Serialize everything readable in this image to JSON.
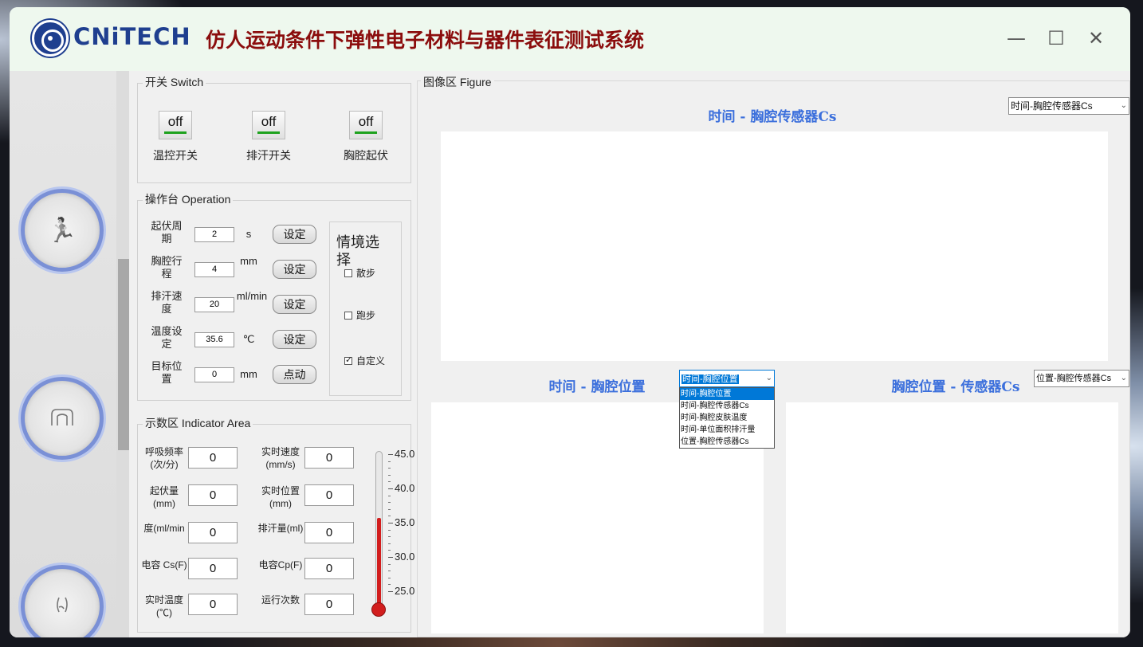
{
  "titlebar": {
    "logo_text": "CNiTECH",
    "app_title": "仿人运动条件下弹性电子材料与器件表征测试系统",
    "minimize_glyph": "—",
    "maximize_glyph": "☐",
    "close_glyph": "✕"
  },
  "nav": {
    "items": [
      {
        "icon": "running-person-icon",
        "glyph": "🏃"
      },
      {
        "icon": "chest-icon",
        "glyph": "⌒"
      },
      {
        "icon": "body-torso-icon",
        "glyph": "ʖ"
      }
    ]
  },
  "switch_panel": {
    "title": "开关 Switch",
    "switches": [
      {
        "state": "off",
        "label": "温控开关"
      },
      {
        "state": "off",
        "label": "排汗开关"
      },
      {
        "state": "off",
        "label": "胸腔起伏"
      }
    ]
  },
  "operation_panel": {
    "title": "操作台 Operation",
    "rows": [
      {
        "label": "起伏周期",
        "value": "2",
        "unit": "s",
        "button": "设定"
      },
      {
        "label": "胸腔行程",
        "value": "4",
        "unit": "mm",
        "button": "设定"
      },
      {
        "label": "排汗速度",
        "value": "20",
        "unit": "ml/min",
        "button": "设定"
      },
      {
        "label": "温度设定",
        "value": "35.6",
        "unit": "℃",
        "button": "设定"
      },
      {
        "label": "目标位置",
        "value": "0",
        "unit": "mm",
        "button": "点动"
      }
    ],
    "scene": {
      "title": "情境选择",
      "options": [
        {
          "label": "散步",
          "checked": false
        },
        {
          "label": "跑步",
          "checked": false
        },
        {
          "label": "自定义",
          "checked": true
        }
      ]
    }
  },
  "indicator_panel": {
    "title": "示数区 Indicator Area",
    "left": [
      {
        "label": "呼吸频率(次/分)",
        "value": "0"
      },
      {
        "label": "起伏量(mm)",
        "value": "0"
      },
      {
        "label": "度(ml/min",
        "value": "0"
      },
      {
        "label": "电容 Cs(F)",
        "value": "0"
      },
      {
        "label": "实时温度(℃)",
        "value": "0"
      }
    ],
    "right": [
      {
        "label": "实时速度(mm/s)",
        "value": "0"
      },
      {
        "label": "实时位置(mm)",
        "value": "0"
      },
      {
        "label": "排汗量(ml)",
        "value": "0"
      },
      {
        "label": "电容Cp(F)",
        "value": "0"
      },
      {
        "label": "运行次数",
        "value": "0"
      }
    ],
    "thermometer": {
      "ticks": [
        "45.0",
        "40.0",
        "35.0",
        "30.0",
        "25.0"
      ],
      "min": 22.5,
      "max": 45.0,
      "level": 35.6,
      "color": "#d21e1e"
    }
  },
  "figure_panel": {
    "title": "图像区 Figure",
    "top_chart": {
      "title": "时间 - 胸腔传感器Cs",
      "combo_value": "时间-胸腔传感器Cs"
    },
    "bottom_left_chart": {
      "title": "时间 - 胸腔位置",
      "combo_value": "时间-胸腔位置",
      "dropdown_options": [
        "时间-胸腔位置",
        "时间-胸腔传感器Cs",
        "时间-胸腔皮肤温度",
        "时间-单位面积排汗量",
        "位置-胸腔传感器Cs"
      ],
      "selected_index": 0
    },
    "bottom_right_chart": {
      "title": "胸腔位置 - 传感器Cs",
      "combo_value": "位置-胸腔传感器Cs"
    }
  },
  "colors": {
    "title_red": "#8b0d0d",
    "logo_blue": "#1f3f8f",
    "chart_title_blue": "#3b6fdc",
    "switch_indicator_green": "#1ea21e",
    "selection_blue": "#0078d7"
  }
}
